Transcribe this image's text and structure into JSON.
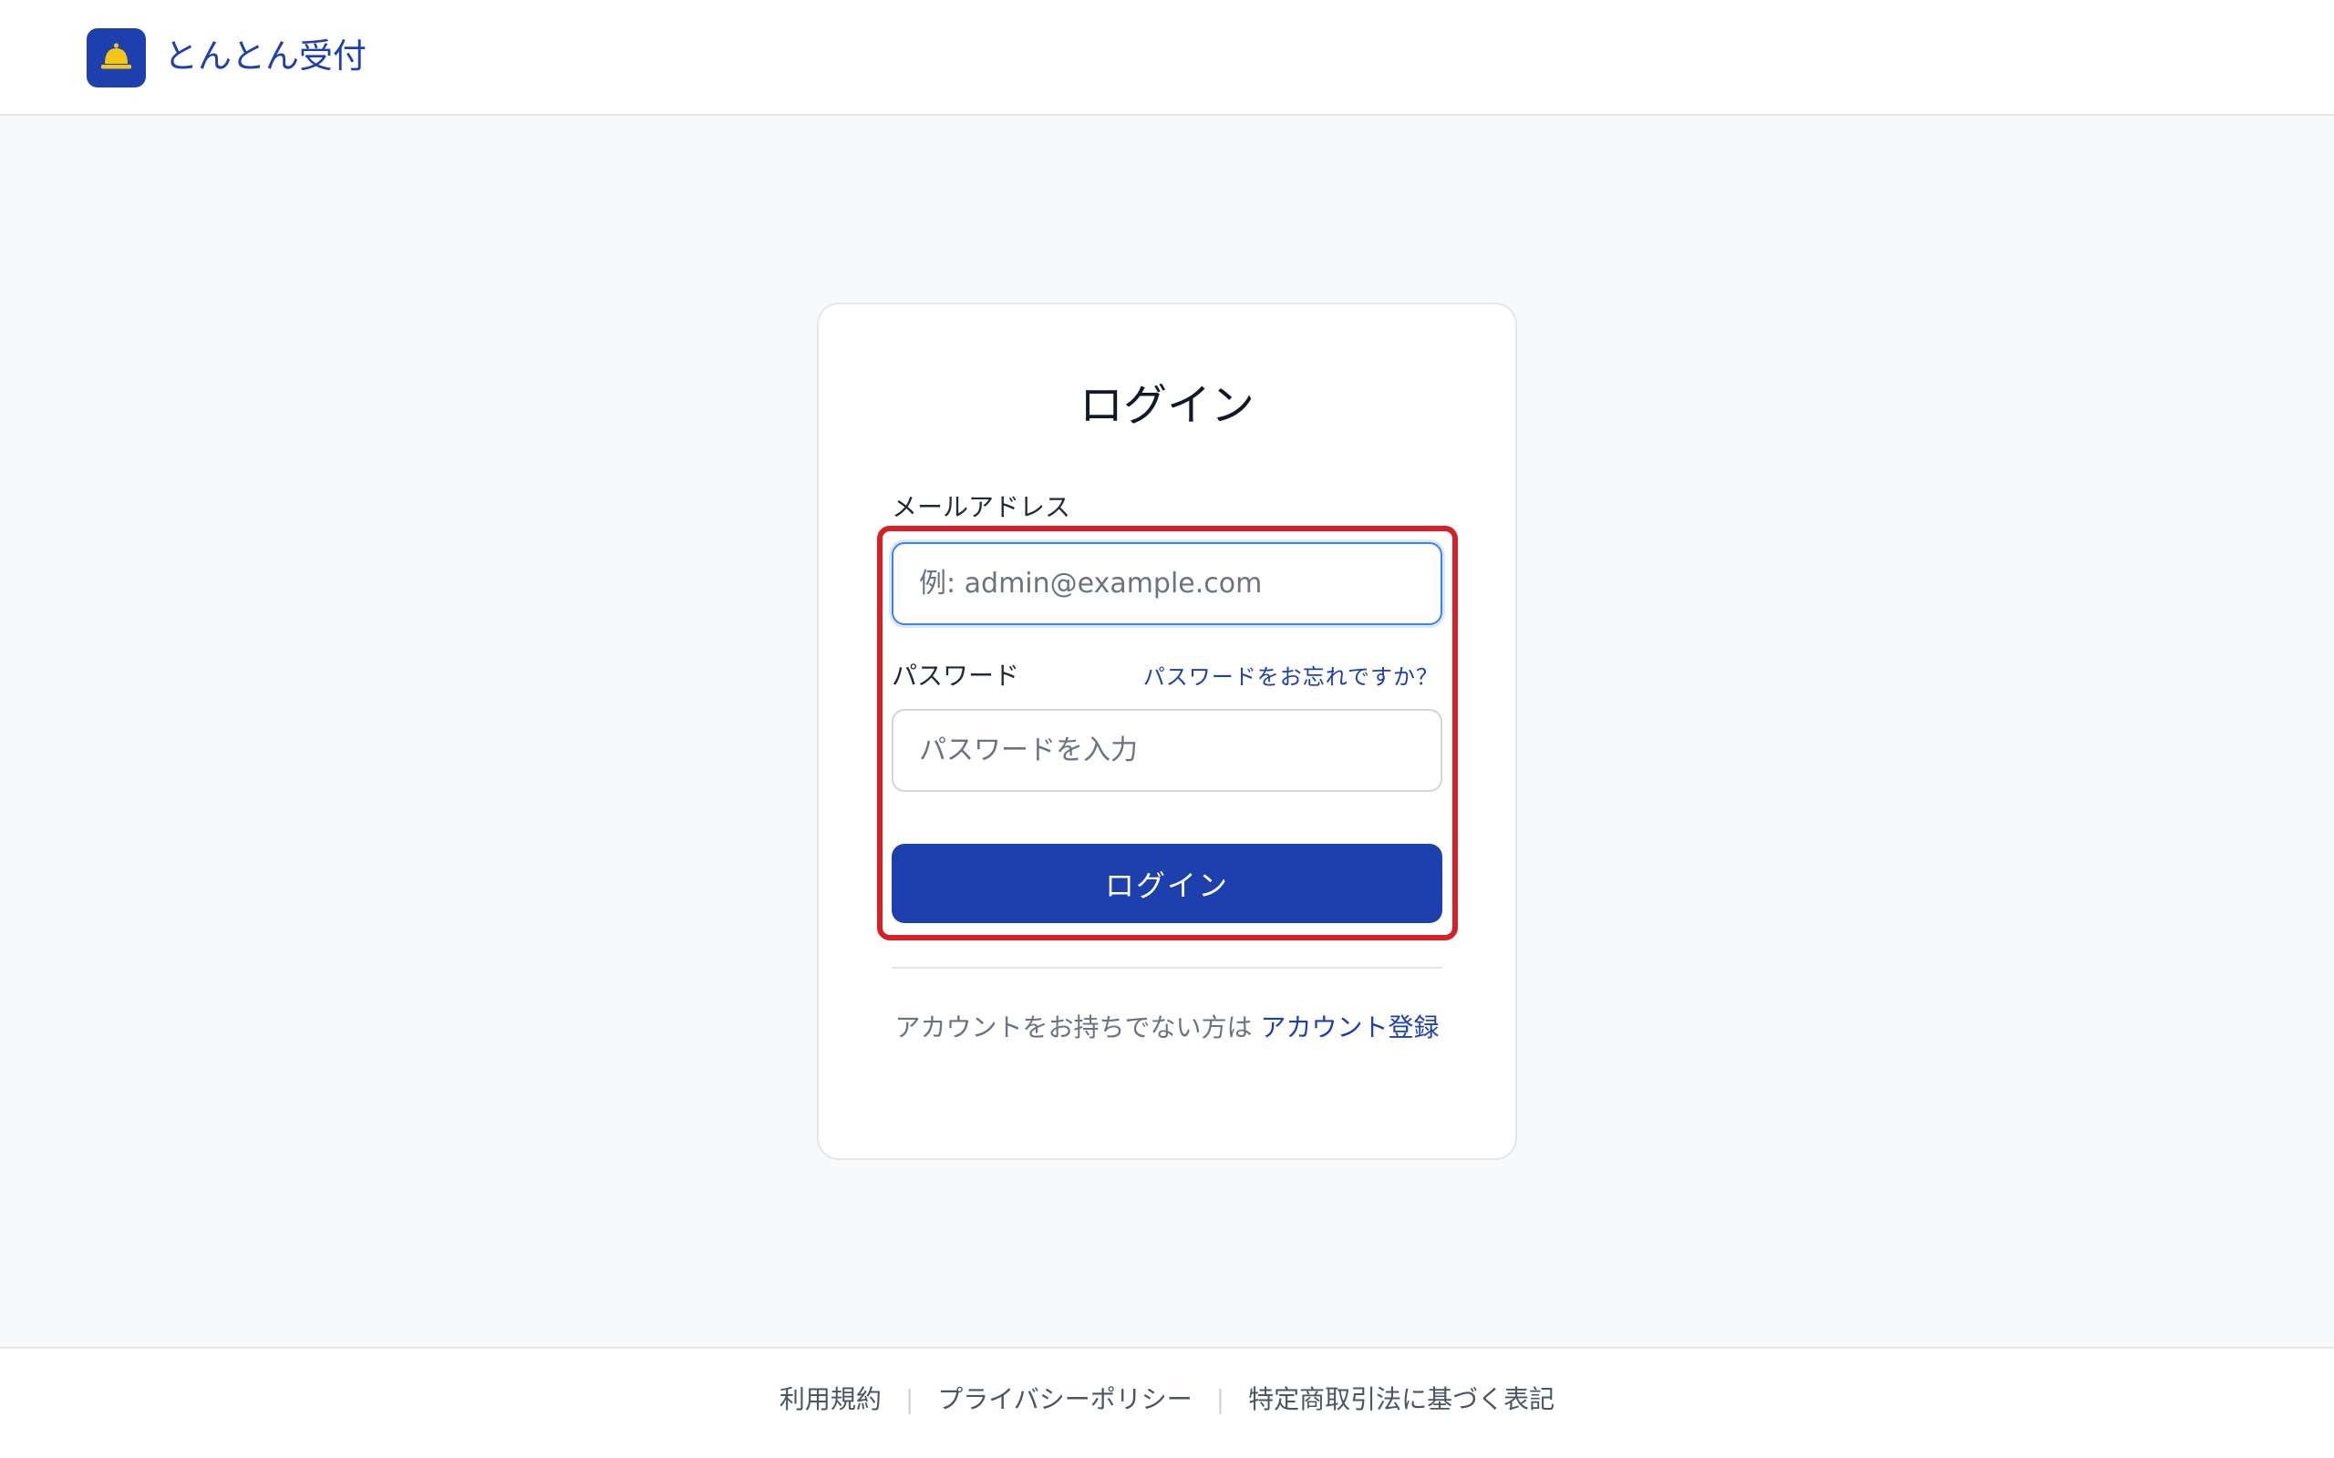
{
  "header": {
    "logo_icon": "bell-icon",
    "brand_name": "とんとん受付"
  },
  "login_card": {
    "title": "ログイン",
    "email": {
      "label": "メールアドレス",
      "value": "",
      "placeholder": "例: admin@example.com"
    },
    "password": {
      "label": "パスワード",
      "value": "",
      "placeholder": "パスワードを入力",
      "forgot_link": "パスワードをお忘れですか？"
    },
    "submit_label": "ログイン",
    "signup_prompt": "アカウントをお持ちでない方は ",
    "signup_link": "アカウント登録"
  },
  "footer": {
    "links": [
      "利用規約",
      "プライバシーポリシー",
      "特定商取引法に基づく表記"
    ],
    "separator": "|"
  },
  "colors": {
    "brand": "#1e40af",
    "bell": "#f5c518",
    "highlight": "#d61f26",
    "focus": "#3b82f6"
  }
}
